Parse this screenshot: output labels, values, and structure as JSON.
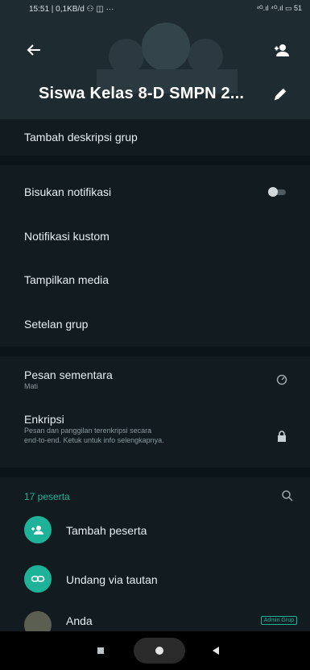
{
  "status_bar": {
    "left": "15:51 | 0,1KB/d ⚇ ◫ ···",
    "right": "⁴ᴳ.ıl ⁴ᴳ.ıl ▭ 51"
  },
  "header": {
    "title": "Siswa Kelas 8-D SMPN 2..."
  },
  "description": {
    "label": "Tambah deskripsi grup"
  },
  "settings": {
    "mute": "Bisukan notifikasi",
    "custom": "Notifikasi kustom",
    "media": "Tampilkan media",
    "group_settings": "Setelan grup"
  },
  "privacy": {
    "disappearing_title": "Pesan sementara",
    "disappearing_sub": "Mati",
    "encryption_title": "Enkripsi",
    "encryption_sub_1": "Pesan dan panggilan terenkripsi secara",
    "encryption_sub_2": "end-to-end. Ketuk untuk info selengkapnya."
  },
  "participants": {
    "count_label": "17 peserta",
    "add_label": "Tambah peserta",
    "invite_label": "Undang via tautan",
    "first_member": "Anda",
    "first_member_badge": "Admin Grup"
  },
  "colors": {
    "accent": "#1eb398",
    "background": "#0b1418",
    "card": "#111b20"
  }
}
